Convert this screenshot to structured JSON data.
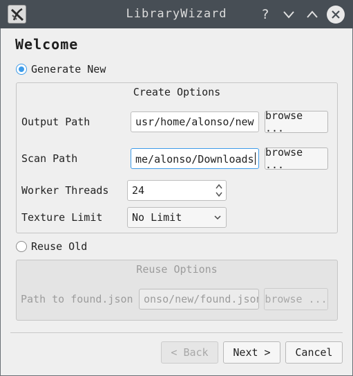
{
  "window": {
    "title": "LibraryWizard"
  },
  "titlebar_icons": [
    "app-icon",
    "help-icon",
    "minimize-icon",
    "maximize-icon",
    "close-icon"
  ],
  "titlebar": {
    "help": "?"
  },
  "page": {
    "heading": "Welcome"
  },
  "generate": {
    "radio_label": "Generate New",
    "checked": true,
    "group_title": "Create Options",
    "output_label": "Output Path",
    "output_value": "usr/home/alonso/new",
    "output_browse": "browse ...",
    "scan_label": "Scan Path",
    "scan_value": "me/alonso/Downloads",
    "scan_browse": "browse ...",
    "threads_label": "Worker Threads",
    "threads_value": "24",
    "texture_label": "Texture Limit",
    "texture_value": "No Limit"
  },
  "reuse": {
    "radio_label": "Reuse Old",
    "checked": false,
    "group_title": "Reuse Options",
    "found_label": "Path to found.json",
    "found_value": "onso/new/found.json",
    "found_browse": "browse ..."
  },
  "footer": {
    "back": "< Back",
    "next": "Next >",
    "cancel": "Cancel"
  },
  "colors": {
    "titlebar": "#474e55",
    "accent": "#3d9be9",
    "background": "#efefef"
  }
}
